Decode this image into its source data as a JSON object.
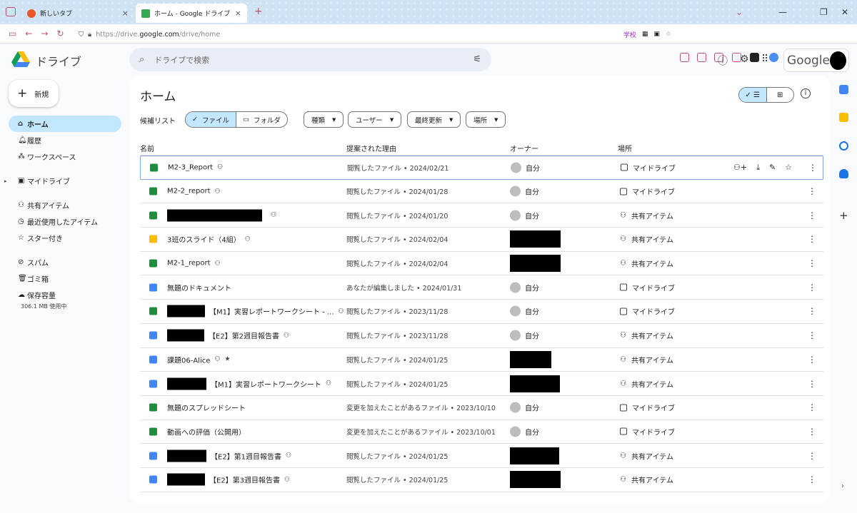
{
  "browser": {
    "tabs": [
      {
        "title": "新しいタブ",
        "active": false
      },
      {
        "title": "ホーム - Google ドライブ",
        "active": true
      }
    ],
    "url_prefix": "https://drive.",
    "url_host": "google.com",
    "url_path": "/drive/home",
    "bookmark_label": "学校"
  },
  "header": {
    "brand": "ドライブ",
    "search_placeholder": "ドライブで検索",
    "account_brand": "Google"
  },
  "sidebar": {
    "new_label": "新規",
    "items": [
      {
        "label": "ホーム",
        "icon": "home-icon",
        "active": true
      },
      {
        "label": "履歴",
        "icon": "bell-icon"
      },
      {
        "label": "ワークスペース",
        "icon": "workspace-icon"
      },
      {
        "label": "マイドライブ",
        "icon": "drive-icon"
      },
      {
        "label": "共有アイテム",
        "icon": "people-icon"
      },
      {
        "label": "最近使用したアイテム",
        "icon": "clock-icon"
      },
      {
        "label": "スター付き",
        "icon": "star-icon"
      },
      {
        "label": "スパム",
        "icon": "spam-icon"
      },
      {
        "label": "ゴミ箱",
        "icon": "trash-icon"
      },
      {
        "label": "保存容量",
        "icon": "cloud-icon"
      }
    ],
    "storage_used": "306.1 MB 使用中"
  },
  "main": {
    "title": "ホーム",
    "suggest_label": "候補リスト",
    "seg_files": "ファイル",
    "seg_folders": "フォルダ",
    "filters": [
      "種類",
      "ユーザー",
      "最終更新",
      "場所"
    ],
    "columns": {
      "name": "名前",
      "reason": "提案された理由",
      "owner": "オーナー",
      "location": "場所"
    },
    "rows": [
      {
        "type": "sheet",
        "name": "M2-3_Report",
        "prefix_redacted": false,
        "shared": true,
        "reason": "閲覧したファイル • 2024/02/21",
        "owner": "自分",
        "location": "マイドライブ",
        "selected": true
      },
      {
        "type": "sheet",
        "name": "M2-2_report",
        "prefix_redacted": false,
        "shared": true,
        "reason": "閲覧したファイル • 2024/01/28",
        "owner": "自分",
        "location": "マイドライブ"
      },
      {
        "type": "sheet",
        "name": "",
        "prefix_redacted": true,
        "shared": true,
        "reason": "閲覧したファイル • 2024/01/20",
        "owner": "自分",
        "location": "共有アイテム"
      },
      {
        "type": "slide",
        "name": "3班のスライド（4組）",
        "prefix_redacted": false,
        "shared": true,
        "reason": "閲覧したファイル • 2024/02/04",
        "owner": "",
        "location": "共有アイテム"
      },
      {
        "type": "sheet",
        "name": "M2-1_report",
        "prefix_redacted": false,
        "shared": true,
        "reason": "閲覧したファイル • 2024/02/04",
        "owner": "",
        "location": "共有アイテム"
      },
      {
        "type": "doc",
        "name": "無題のドキュメント",
        "prefix_redacted": false,
        "shared": false,
        "reason": "あなたが編集しました • 2024/01/31",
        "owner": "自分",
        "location": "マイドライブ"
      },
      {
        "type": "sheet",
        "name": "【M1】実習レポートワークシート - ...",
        "prefix_redacted": true,
        "shared": true,
        "reason": "閲覧したファイル • 2023/11/28",
        "owner": "自分",
        "location": "マイドライブ"
      },
      {
        "type": "doc",
        "name": "【E2】第2週目報告書",
        "prefix_redacted": true,
        "shared": true,
        "reason": "閲覧したファイル • 2023/11/28",
        "owner": "自分",
        "location": "共有アイテム"
      },
      {
        "type": "doc",
        "name": "課題06-Alice",
        "prefix_redacted": false,
        "shared": true,
        "starred": true,
        "reason": "閲覧したファイル • 2024/01/25",
        "owner": "",
        "location": "共有アイテム"
      },
      {
        "type": "doc",
        "name": "【M1】実習レポートワークシート",
        "prefix_redacted": true,
        "shared": true,
        "reason": "閲覧したファイル • 2024/01/25",
        "owner": "",
        "location": "共有アイテム"
      },
      {
        "type": "sheet",
        "name": "無題のスプレッドシート",
        "prefix_redacted": false,
        "shared": false,
        "reason": "変更を加えたことがあるファイル • 2023/10/10",
        "owner": "自分",
        "location": "マイドライブ"
      },
      {
        "type": "sheet",
        "name": "動画への評価（公開用）",
        "prefix_redacted": false,
        "shared": false,
        "reason": "変更を加えたことがあるファイル • 2023/10/01",
        "owner": "自分",
        "location": "マイドライブ"
      },
      {
        "type": "doc",
        "name": "【E2】第1週目報告書",
        "prefix_redacted": true,
        "shared": true,
        "reason": "閲覧したファイル • 2024/01/25",
        "owner": "",
        "location": "共有アイテム"
      },
      {
        "type": "doc",
        "name": "【E2】第3週目報告書",
        "prefix_redacted": true,
        "shared": true,
        "reason": "閲覧したファイル • 2024/01/25",
        "owner": "",
        "location": "共有アイテム"
      }
    ]
  }
}
